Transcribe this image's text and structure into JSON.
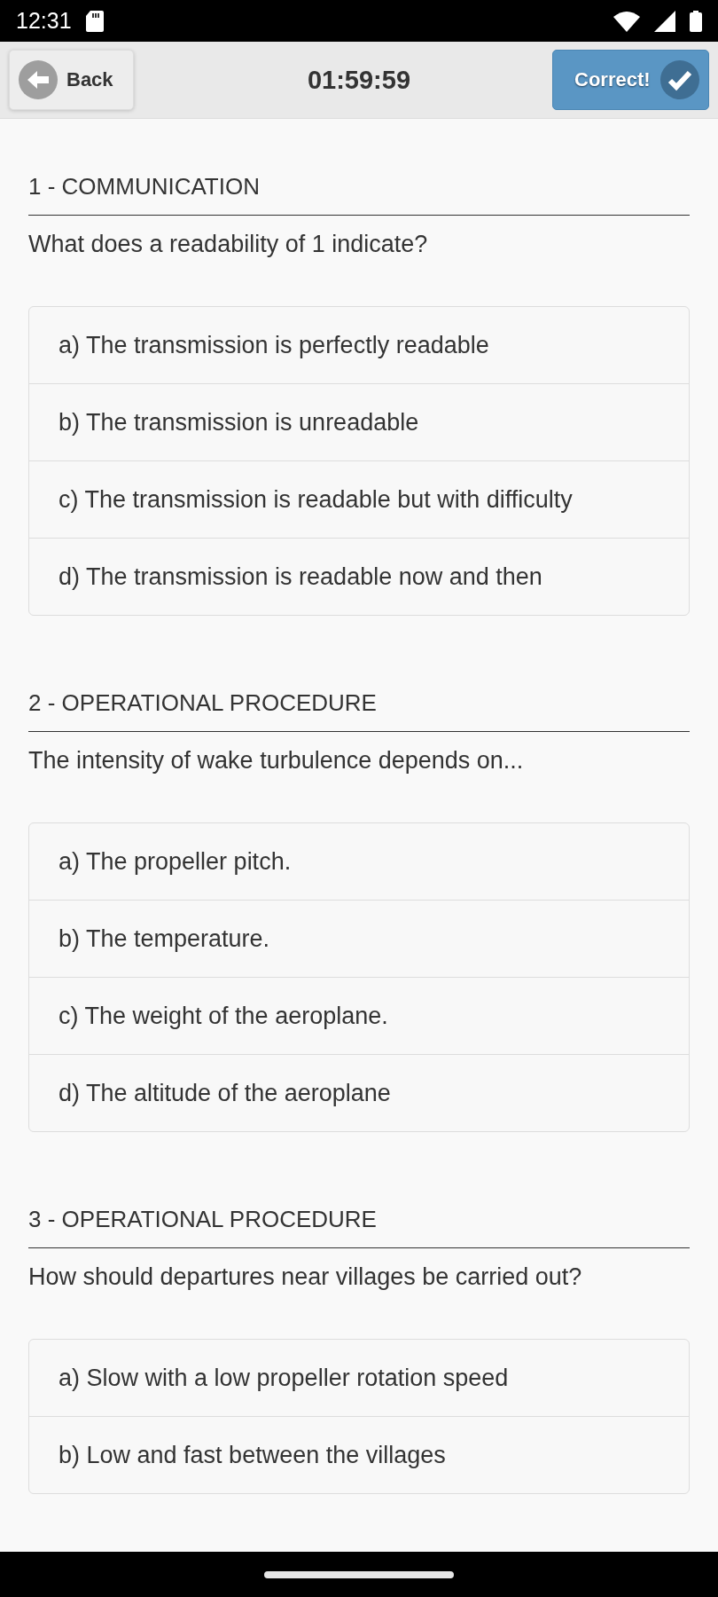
{
  "status_bar": {
    "time": "12:31"
  },
  "header": {
    "back_label": "Back",
    "timer": "01:59:59",
    "correct_label": "Correct!"
  },
  "questions": [
    {
      "category": "1 - COMMUNICATION",
      "question": "What does a readability of 1 indicate?",
      "answers": [
        "a) The transmission is perfectly readable",
        "b) The transmission is unreadable",
        "c) The transmission is readable but with difficulty",
        "d) The transmission is readable now and then"
      ]
    },
    {
      "category": "2 - OPERATIONAL PROCEDURE",
      "question": "The intensity of wake turbulence depends on...",
      "answers": [
        "a) The propeller pitch.",
        "b) The temperature.",
        "c) The weight of the aeroplane.",
        "d) The altitude of the aeroplane"
      ]
    },
    {
      "category": "3 - OPERATIONAL PROCEDURE",
      "question": "How should departures near villages be carried out?",
      "answers": [
        "a) Slow with a low propeller rotation speed",
        "b) Low and fast between the villages"
      ]
    }
  ]
}
